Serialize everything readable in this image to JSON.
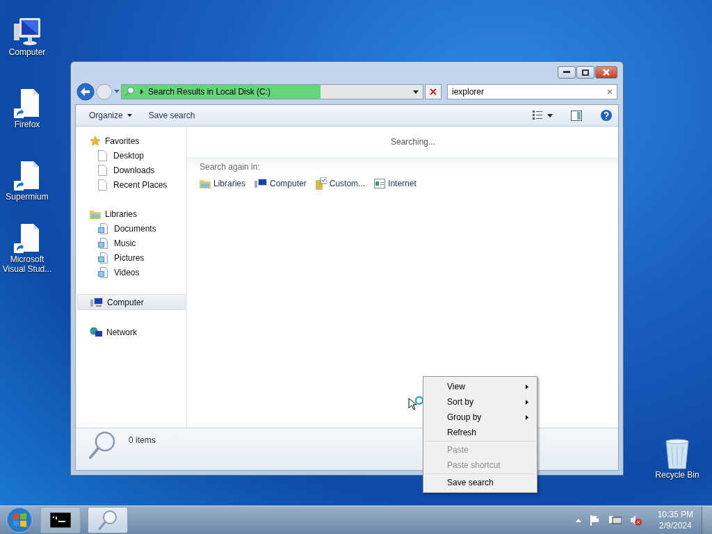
{
  "desktop_icons": [
    {
      "label": "Computer",
      "kind": "computer"
    },
    {
      "label": "Firefox",
      "kind": "shortcut"
    },
    {
      "label": "Supermium",
      "kind": "shortcut"
    },
    {
      "label": "Microsoft Visual Stud...",
      "kind": "shortcut"
    }
  ],
  "recycle_bin": {
    "label": "Recycle Bin"
  },
  "window": {
    "address": {
      "text": "Search Results in Local Disk (C:)",
      "level": 0.66
    },
    "search": {
      "value": "iexplorer"
    },
    "toolbar": [
      {
        "label": "Organize",
        "kind": "menu"
      },
      {
        "label": "Save search",
        "kind": "button"
      }
    ],
    "nav": [
      {
        "label": "Favorites",
        "kind": "star",
        "selected": false,
        "children": [
          {
            "label": "Desktop",
            "kind": "page",
            "selected": false
          },
          {
            "label": "Downloads",
            "kind": "page",
            "selected": false
          },
          {
            "label": "Recent Places",
            "kind": "page",
            "selected": false
          }
        ]
      },
      {
        "label": "Libraries",
        "kind": "library",
        "selected": false,
        "children": [
          {
            "label": "Documents",
            "kind": "libdoc",
            "selected": false
          },
          {
            "label": "Music",
            "kind": "libdoc",
            "selected": false
          },
          {
            "label": "Pictures",
            "kind": "libdoc",
            "selected": false
          },
          {
            "label": "Videos",
            "kind": "libdoc",
            "selected": false
          }
        ]
      },
      {
        "label": "Computer",
        "kind": "computer",
        "selected": true
      },
      {
        "label": "Network",
        "kind": "network",
        "selected": false
      }
    ],
    "status": "Searching...",
    "search_again": {
      "label": "Search again in:",
      "locations": [
        {
          "label": "Libraries",
          "kind": "library"
        },
        {
          "label": "Computer",
          "kind": "computer"
        },
        {
          "label": "Custom...",
          "kind": "custom"
        },
        {
          "label": "Internet",
          "kind": "internet"
        }
      ]
    },
    "details": {
      "count": "0 items"
    }
  },
  "context_menu": {
    "groups": [
      [
        {
          "label": "View",
          "submenu": true,
          "disabled": false
        },
        {
          "label": "Sort by",
          "submenu": true,
          "disabled": false
        },
        {
          "label": "Group by",
          "submenu": true,
          "disabled": false
        },
        {
          "label": "Refresh",
          "submenu": false,
          "disabled": false
        }
      ],
      [
        {
          "label": "Paste",
          "submenu": false,
          "disabled": true
        },
        {
          "label": "Paste shortcut",
          "submenu": false,
          "disabled": true
        }
      ],
      [
        {
          "label": "Save search",
          "submenu": false,
          "disabled": false
        }
      ]
    ]
  },
  "taskbar": {
    "buttons": [
      {
        "kind": "console",
        "selected": false
      },
      {
        "kind": "search",
        "selected": true
      }
    ],
    "clock": {
      "time": "10:35 PM",
      "date": "2/9/2024"
    }
  }
}
